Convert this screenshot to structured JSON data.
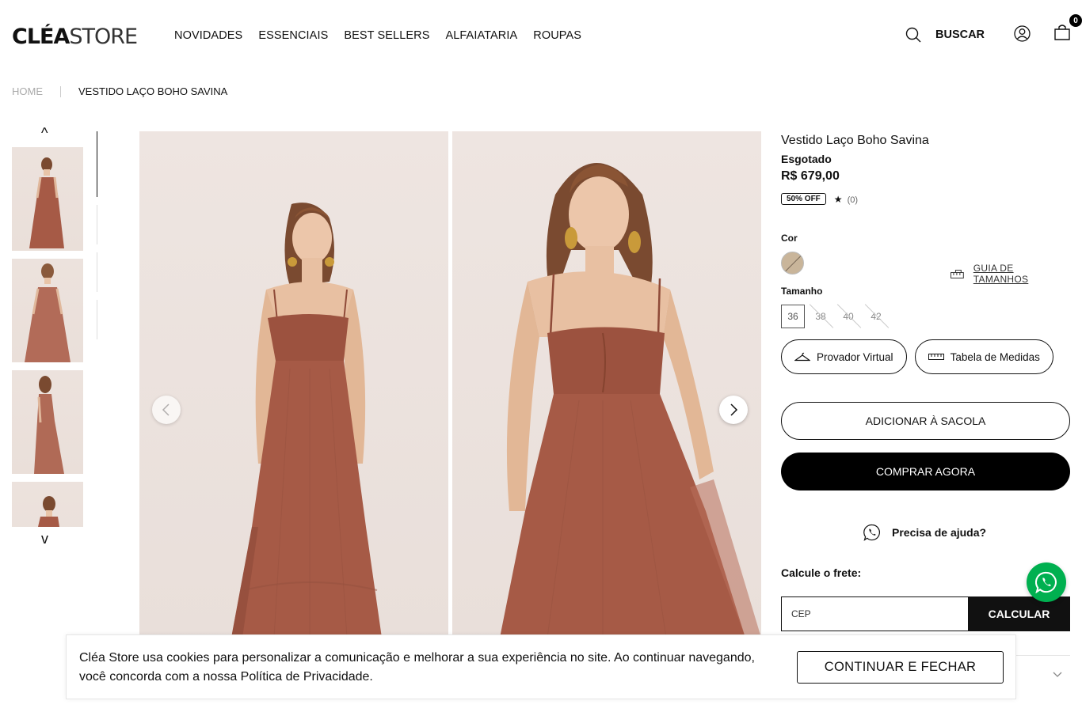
{
  "header": {
    "logo_bold": "CLÉA",
    "logo_light": "STORE",
    "nav": [
      "NOVIDADES",
      "ESSENCIAIS",
      "BEST SELLERS",
      "ALFAIATARIA",
      "ROUPAS"
    ],
    "search_label": "BUSCAR",
    "bag_count": "0"
  },
  "breadcrumb": {
    "home": "HOME",
    "current": "VESTIDO LAÇO BOHO SAVINA"
  },
  "thumbnails": {
    "up": "^",
    "down": "v",
    "count": 4
  },
  "product": {
    "title": "Vestido Laço Boho Savina",
    "status": "Esgotado",
    "price": "R$ 679,00",
    "discount_badge": "50% OFF",
    "rating_star": "★",
    "rating_count": "(0)",
    "color_label": "Cor",
    "size_guide": "GUIA DE TAMANHOS",
    "size_label": "Tamanho",
    "sizes": [
      "36",
      "38",
      "40",
      "42"
    ],
    "virtual_fitting": "Provador Virtual",
    "measure_table": "Tabela de Medidas",
    "add_to_bag": "ADICIONAR À SACOLA",
    "buy_now": "COMPRAR AGORA",
    "help": "Precisa de ajuda?",
    "shipping_label": "Calcule o frete:",
    "cep_placeholder": "CEP",
    "calculate": "CALCULAR"
  },
  "cookie": {
    "text": "Cléa Store usa cookies para personalizar a comunicação e melhorar a sua experiência no site. Ao continuar navegando, você concorda com a nossa Política de Privacidade.",
    "button": "CONTINUAR E FECHAR"
  },
  "colors": {
    "dress": "#a65a46",
    "photo_bg": "#ece3de",
    "swatch": "#c9b59a",
    "whatsapp": "#00b050"
  }
}
